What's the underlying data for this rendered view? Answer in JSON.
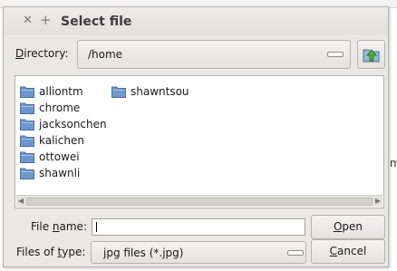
{
  "background": {
    "partial_text": "m"
  },
  "titlebar": {
    "close_glyph": "✕",
    "pin_glyph": "+",
    "title": "Select file"
  },
  "directory": {
    "label_underlined": "D",
    "label_rest": "irectory:",
    "value": "/home",
    "up_button_icon": "folder-up-icon"
  },
  "files": {
    "items": [
      {
        "name": "alliontm"
      },
      {
        "name": "chrome"
      },
      {
        "name": "jacksonchen"
      },
      {
        "name": "kalichen"
      },
      {
        "name": "ottowei"
      },
      {
        "name": "shawnli"
      },
      {
        "name": "shawntsou"
      }
    ]
  },
  "file_name": {
    "label_prefix": "File ",
    "label_underlined": "n",
    "label_suffix": "ame:",
    "value": ""
  },
  "file_type": {
    "label_prefix": "Files of ",
    "label_underlined": "t",
    "label_suffix": "ype:",
    "value": "jpg files (*.jpg)"
  },
  "buttons": {
    "open_underlined": "O",
    "open_rest": "pen",
    "cancel_underlined": "C",
    "cancel_rest": "ancel"
  },
  "colors": {
    "folder": "#6f97c9",
    "folder_dark": "#4a6f9e",
    "up_arrow": "#3f9a2f"
  }
}
